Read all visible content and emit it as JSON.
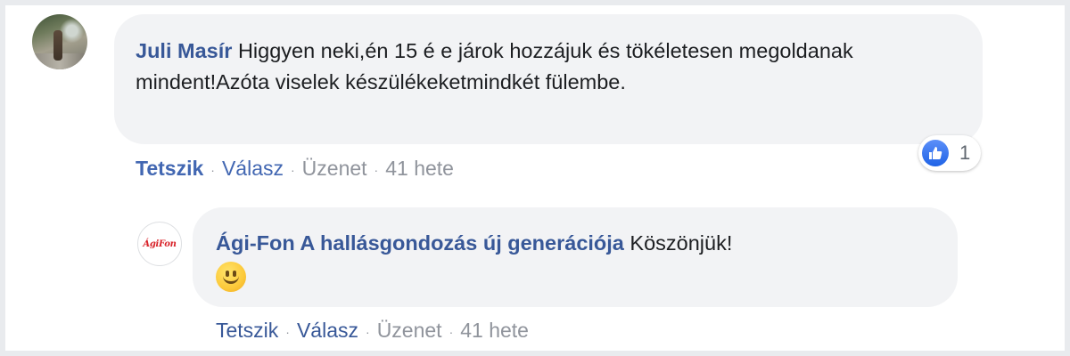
{
  "comment": {
    "author": "Juli Masír",
    "text": "Higgyen neki,én 15 é e járok hozzájuk és tökéletesen megoldanak mindent!Azóta viselek készülékeketmindkét fülembe.",
    "actions": {
      "like": "Tetszik",
      "reply": "Válasz",
      "message": "Üzenet",
      "time": "41 hete"
    },
    "reaction": {
      "icon": "thumbs-up-icon",
      "count": "1",
      "color": "#1f63e6"
    }
  },
  "reply": {
    "author": "Ági-Fon A hallásgondozás új generációja",
    "text": "Köszönjük!",
    "emoji": "smiley-icon",
    "avatar_text": "ÁgiFon",
    "actions": {
      "like": "Tetszik",
      "reply": "Válasz",
      "message": "Üzenet",
      "time": "41 hete"
    }
  },
  "separator": "·",
  "colors": {
    "link": "#385898",
    "bubble": "#f2f3f5",
    "meta": "#90949c",
    "brand_red": "#d8232a"
  }
}
